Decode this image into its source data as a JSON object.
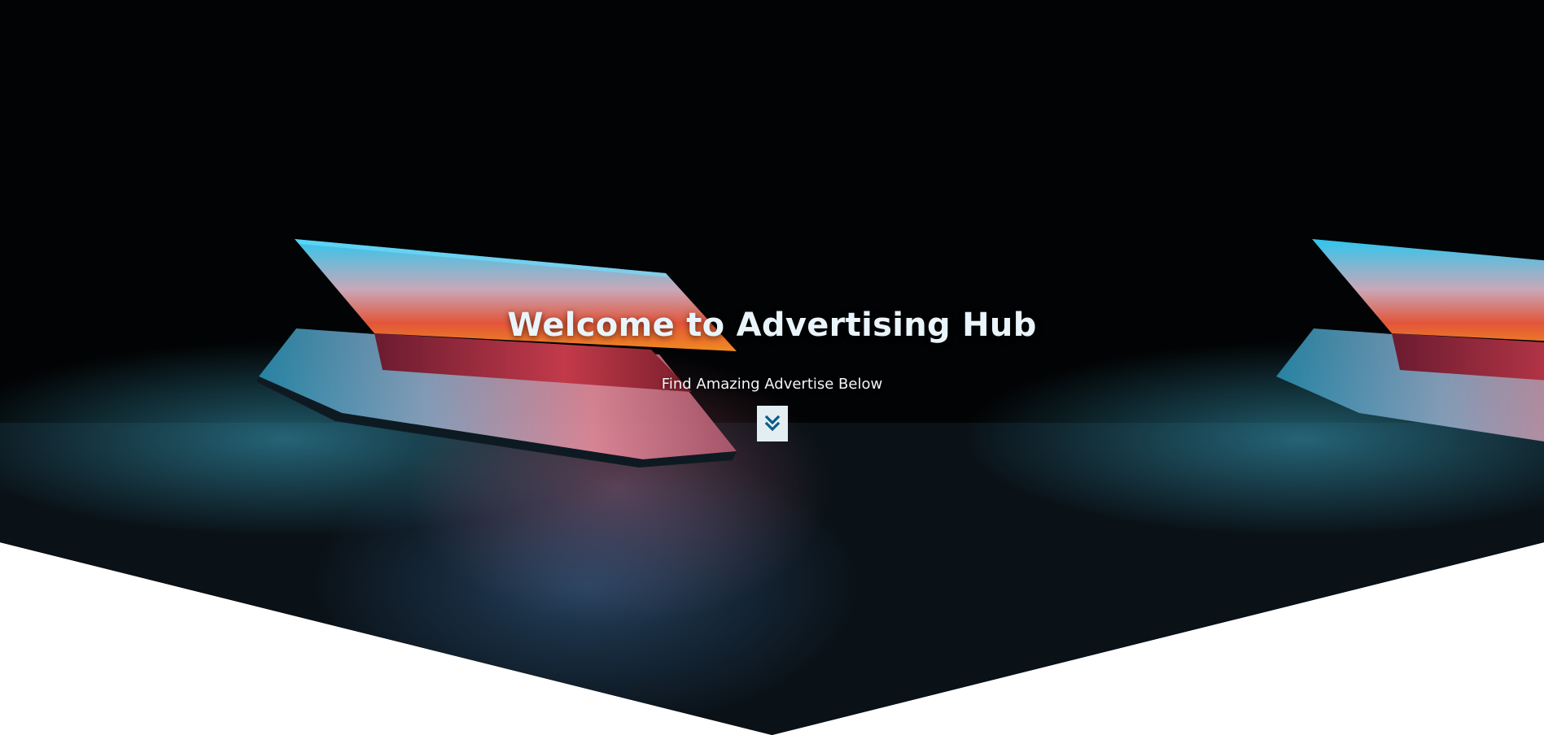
{
  "hero": {
    "title": "Welcome to Advertising Hub",
    "subtitle": "Find Amazing Advertise Below",
    "scroll_button_icon": "double-chevron-down-icon"
  },
  "colors": {
    "hero_background": "#020304",
    "title_text": "#e9f4fb",
    "subtitle_text": "#f2f6f8",
    "scroll_button_bg": "#e3eef3",
    "scroll_button_icon": "#0b5d86",
    "page_background": "#ffffff"
  }
}
